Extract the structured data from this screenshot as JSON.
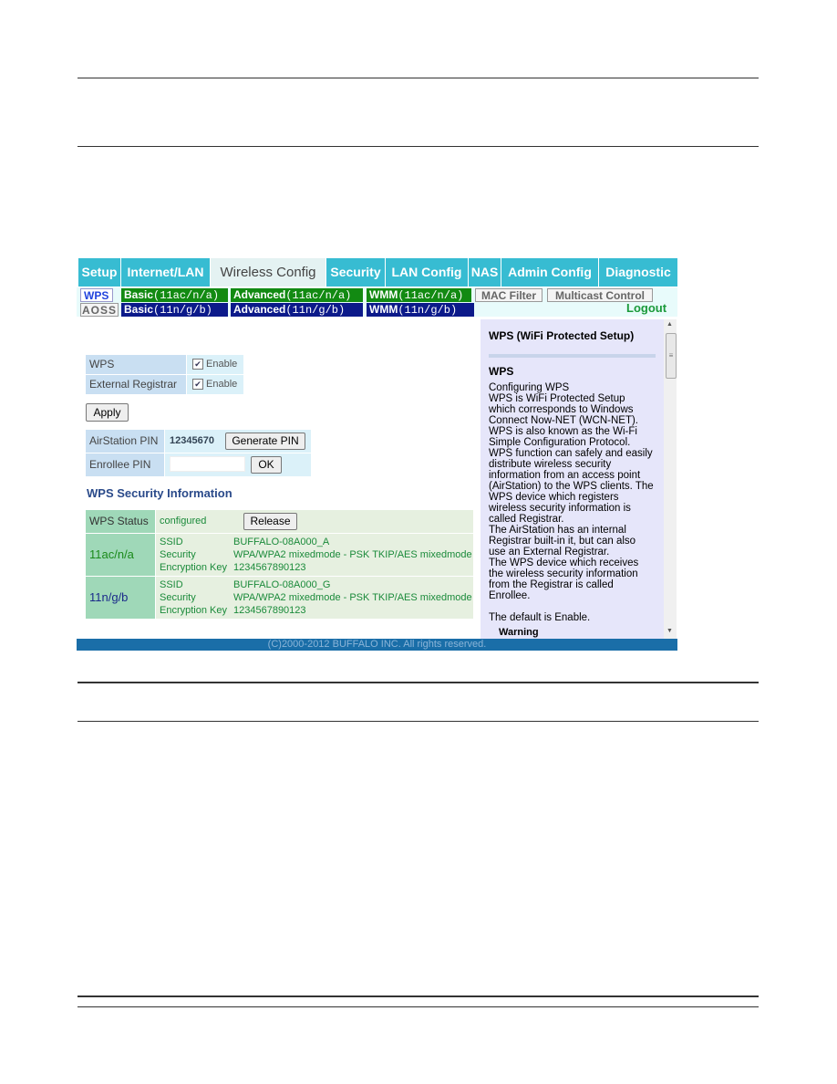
{
  "nav": {
    "tabs": [
      "Setup",
      "Internet/LAN",
      "Wireless Config",
      "Security",
      "LAN Config",
      "NAS",
      "Admin Config",
      "Diagnostic"
    ],
    "active": "Wireless Config"
  },
  "subnav": {
    "wps": "WPS",
    "aoss": "AOSS",
    "basic_ac": "Basic",
    "basic_ac_m": "(11ac/n/a)",
    "adv_ac": "Advanced",
    "adv_ac_m": "(11ac/n/a)",
    "wmm_ac": "WMM",
    "wmm_ac_m": "(11ac/n/a)",
    "basic_n": "Basic",
    "basic_n_m": "(11n/g/b)",
    "adv_n": "Advanced",
    "adv_n_m": "(11n/g/b)",
    "wmm_n": "WMM",
    "wmm_n_m": "(11n/g/b)",
    "mac": "MAC Filter",
    "multicast": "Multicast Control",
    "logout": "Logout"
  },
  "form": {
    "wps_label": "WPS",
    "wps_enable": "Enable",
    "wps_checked": true,
    "ext_label": "External Registrar",
    "ext_enable": "Enable",
    "ext_checked": true,
    "apply": "Apply",
    "pin_label": "AirStation PIN",
    "pin_value": "12345670",
    "generate": "Generate PIN",
    "enrollee_label": "Enrollee PIN",
    "enrollee_value": "",
    "ok": "OK"
  },
  "security": {
    "title": "WPS Security Information",
    "status_label": "WPS Status",
    "status_value": "configured",
    "release": "Release",
    "bands": [
      {
        "name": "11ac/n/a",
        "ssid_label": "SSID",
        "ssid": "BUFFALO-08A000_A",
        "security_label": "Security",
        "security": "WPA/WPA2 mixedmode - PSK TKIP/AES mixedmode",
        "key_label": "Encryption Key",
        "key": "1234567890123"
      },
      {
        "name": "11n/g/b",
        "ssid_label": "SSID",
        "ssid": "BUFFALO-08A000_G",
        "security_label": "Security",
        "security": "WPA/WPA2 mixedmode - PSK TKIP/AES mixedmode",
        "key_label": "Encryption Key",
        "key": "1234567890123"
      }
    ]
  },
  "help": {
    "title": "WPS (WiFi Protected Setup)",
    "heading": "WPS",
    "body": "Configuring WPS\nWPS is WiFi Protected Setup which corresponds to Windows Connect Now-NET (WCN-NET). WPS is also known as the Wi-Fi Simple Configuration Protocol. WPS function can safely and easily distribute wireless security information from an access point (AirStation) to the WPS clients. The WPS device which registers wireless security information is called Registrar.\nThe AirStation has an internal Registrar built-in it, but can also use an External Registrar.\nThe WPS device which receives the wireless security information from the Registrar is called Enrollee.\n\nThe default is Enable.",
    "warning": "Warning"
  },
  "footer": "(C)2000-2012 BUFFALO INC. All rights reserved."
}
